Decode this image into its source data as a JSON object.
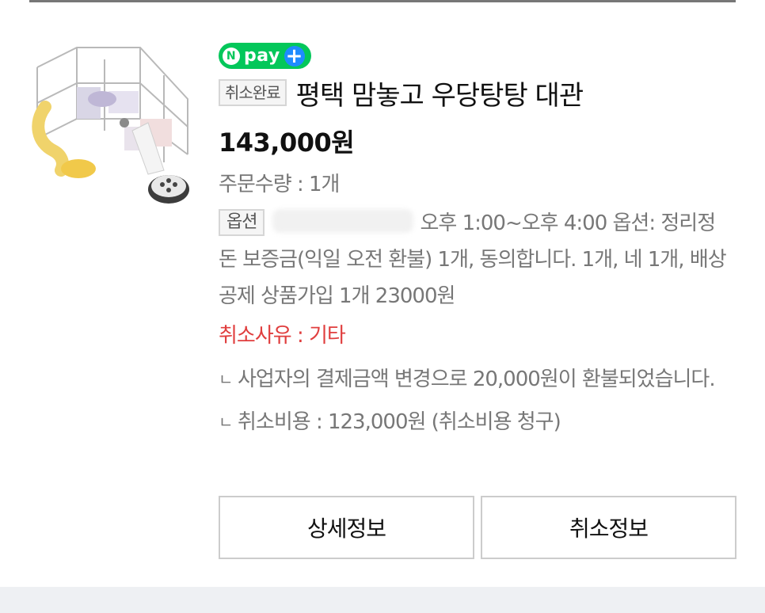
{
  "order": {
    "pay_badge": {
      "n_letter": "N",
      "label": "pay",
      "plus": "+",
      "color": "#03c75a",
      "plus_color": "#1e8cff"
    },
    "status": "취소완료",
    "product_title": "평택 맘놓고 우당탕탕 대관",
    "price": "143,000원",
    "quantity": "주문수량 : 1개",
    "option_label": "옵션",
    "option_text": "오후 1:00~오후 4:00 옵션: 정리정돈 보증금(익일 오전 환불) 1개, 동의합니다. 1개, 네 1개, 배상 공제 상품가입 1개 23000원",
    "cancel_reason": "취소사유 : 기타",
    "refund_note": "사업자의 결제금액 변경으로 20,000원이 환불되었습니다.",
    "cancel_fee": "취소비용 : 123,000원 (취소비용 청구)",
    "bullet": "ㄴ",
    "colors": {
      "cancel_reason": "#e03e3e",
      "muted_text": "#777777"
    }
  },
  "actions": {
    "detail_button": "상세정보",
    "cancel_info_button": "취소정보"
  }
}
